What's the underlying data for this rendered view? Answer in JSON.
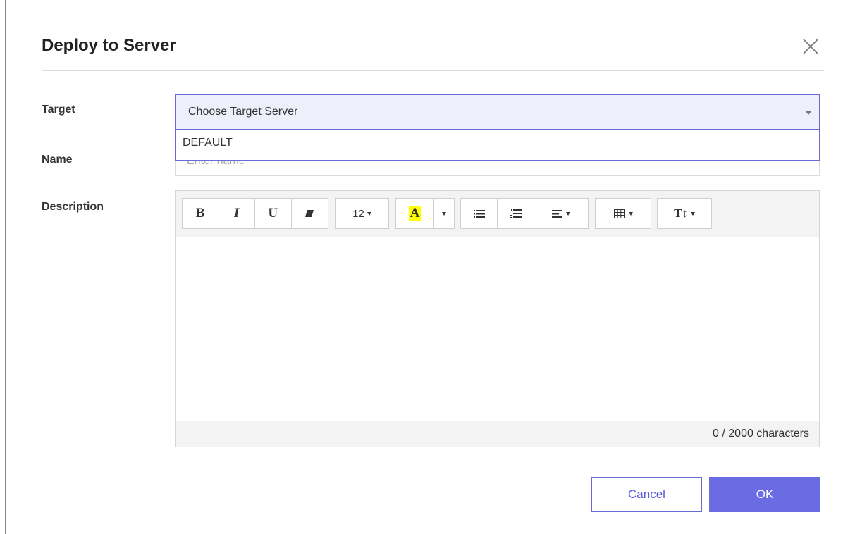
{
  "dialog": {
    "title": "Deploy to Server",
    "close_icon": "close-icon"
  },
  "form": {
    "target_label": "Target",
    "name_label": "Name",
    "description_label": "Description",
    "target_select": {
      "selected": "Choose Target Server",
      "options": [
        "DEFAULT"
      ]
    },
    "name_input": {
      "placeholder": "Enter name",
      "value": ""
    }
  },
  "toolbar": {
    "bold": "B",
    "italic": "I",
    "underline": "U",
    "eraser_icon": "eraser-icon",
    "font_size": "12",
    "text_color": "A",
    "unordered_list_icon": "unordered-list-icon",
    "ordered_list_icon": "ordered-list-icon",
    "align_icon": "align-icon",
    "table_icon": "table-icon",
    "line_height_label": "T↕"
  },
  "editor": {
    "content": "",
    "char_count": "0 / 2000 characters"
  },
  "buttons": {
    "cancel": "Cancel",
    "ok": "OK"
  },
  "colors": {
    "accent": "#6b6be3",
    "select_bg": "#eeeffb",
    "highlight": "#ffff00"
  }
}
